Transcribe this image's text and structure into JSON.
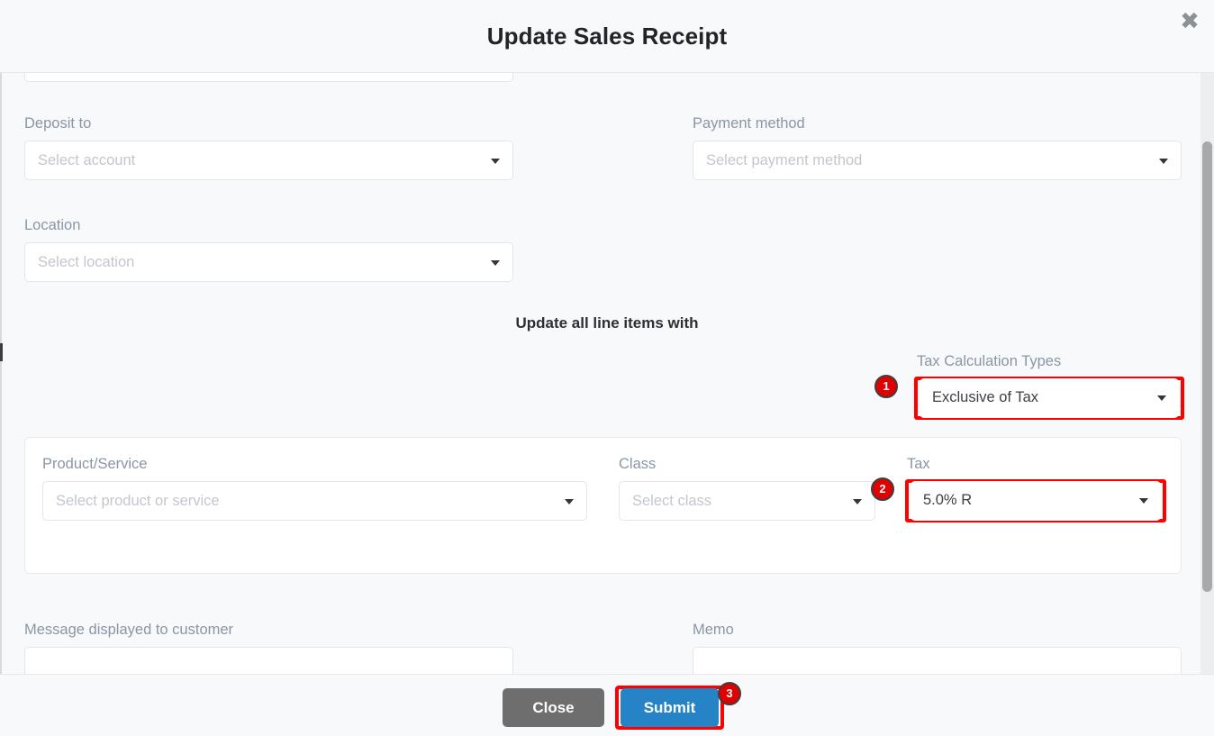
{
  "modal": {
    "title": "Update Sales Receipt",
    "close_icon": "close-x-icon"
  },
  "form": {
    "deposit_to": {
      "label": "Deposit to",
      "placeholder": "Select account",
      "value": ""
    },
    "payment_method": {
      "label": "Payment method",
      "placeholder": "Select payment method",
      "value": ""
    },
    "location": {
      "label": "Location",
      "placeholder": "Select location",
      "value": ""
    },
    "message_to_customer": {
      "label": "Message displayed to customer",
      "value": ""
    },
    "memo": {
      "label": "Memo",
      "value": ""
    }
  },
  "bulk_update": {
    "heading": "Update all line items with",
    "tax_calculation_types": {
      "label": "Tax Calculation Types",
      "value": "Exclusive of Tax"
    }
  },
  "line_item": {
    "product_service": {
      "label": "Product/Service",
      "placeholder": "Select product or service",
      "value": ""
    },
    "class": {
      "label": "Class",
      "placeholder": "Select class",
      "value": ""
    },
    "tax": {
      "label": "Tax",
      "value": "5.0% R"
    }
  },
  "footer": {
    "close_label": "Close",
    "submit_label": "Submit"
  },
  "annotations": {
    "badge_1": "1",
    "badge_2": "2",
    "badge_3": "3"
  },
  "colors": {
    "highlight": "#ff0000",
    "badge_fill": "#e00000",
    "submit": "#2684c6",
    "close": "#6e6e6e",
    "body_bg": "#f8f9fb",
    "label_text": "#8a96a6"
  }
}
